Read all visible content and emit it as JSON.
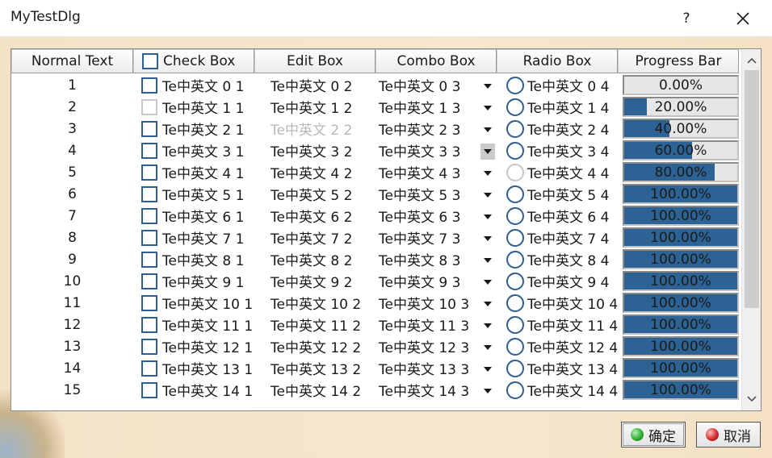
{
  "window": {
    "title": "MyTestDlg",
    "help_label": "?",
    "close_icon": "close-icon"
  },
  "columns": [
    "Normal Text",
    "Check Box",
    "Edit Box",
    "Combo Box",
    "Radio Box",
    "Progress Bar"
  ],
  "rows": [
    {
      "num": "1",
      "check": "Te中英文 0 1",
      "edit": "Te中英文 0 2",
      "combo": "Te中英文 0 3",
      "radio": "Te中英文 0 4",
      "progress": 0.0,
      "progress_text": "0.00%",
      "check_enabled": true,
      "edit_enabled": true,
      "combo_active": false,
      "radio_enabled": true
    },
    {
      "num": "2",
      "check": "Te中英文 1 1",
      "edit": "Te中英文 1 2",
      "combo": "Te中英文 1 3",
      "radio": "Te中英文 1 4",
      "progress": 20.0,
      "progress_text": "20.00%",
      "check_enabled": false,
      "edit_enabled": true,
      "combo_active": false,
      "radio_enabled": true
    },
    {
      "num": "3",
      "check": "Te中英文 2 1",
      "edit": "Te中英文 2 2",
      "combo": "Te中英文 2 3",
      "radio": "Te中英文 2 4",
      "progress": 40.0,
      "progress_text": "40.00%",
      "check_enabled": true,
      "edit_enabled": false,
      "combo_active": false,
      "radio_enabled": true
    },
    {
      "num": "4",
      "check": "Te中英文 3 1",
      "edit": "Te中英文 3 2",
      "combo": "Te中英文 3 3",
      "radio": "Te中英文 3 4",
      "progress": 60.0,
      "progress_text": "60.00%",
      "check_enabled": true,
      "edit_enabled": true,
      "combo_active": true,
      "radio_enabled": true
    },
    {
      "num": "5",
      "check": "Te中英文 4 1",
      "edit": "Te中英文 4 2",
      "combo": "Te中英文 4 3",
      "radio": "Te中英文 4 4",
      "progress": 80.0,
      "progress_text": "80.00%",
      "check_enabled": true,
      "edit_enabled": true,
      "combo_active": false,
      "radio_enabled": false
    },
    {
      "num": "6",
      "check": "Te中英文 5 1",
      "edit": "Te中英文 5 2",
      "combo": "Te中英文 5 3",
      "radio": "Te中英文 5 4",
      "progress": 100.0,
      "progress_text": "100.00%",
      "check_enabled": true,
      "edit_enabled": true,
      "combo_active": false,
      "radio_enabled": true
    },
    {
      "num": "7",
      "check": "Te中英文 6 1",
      "edit": "Te中英文 6 2",
      "combo": "Te中英文 6 3",
      "radio": "Te中英文 6 4",
      "progress": 100.0,
      "progress_text": "100.00%",
      "check_enabled": true,
      "edit_enabled": true,
      "combo_active": false,
      "radio_enabled": true
    },
    {
      "num": "8",
      "check": "Te中英文 7 1",
      "edit": "Te中英文 7 2",
      "combo": "Te中英文 7 3",
      "radio": "Te中英文 7 4",
      "progress": 100.0,
      "progress_text": "100.00%",
      "check_enabled": true,
      "edit_enabled": true,
      "combo_active": false,
      "radio_enabled": true
    },
    {
      "num": "9",
      "check": "Te中英文 8 1",
      "edit": "Te中英文 8 2",
      "combo": "Te中英文 8 3",
      "radio": "Te中英文 8 4",
      "progress": 100.0,
      "progress_text": "100.00%",
      "check_enabled": true,
      "edit_enabled": true,
      "combo_active": false,
      "radio_enabled": true
    },
    {
      "num": "10",
      "check": "Te中英文 9 1",
      "edit": "Te中英文 9 2",
      "combo": "Te中英文 9 3",
      "radio": "Te中英文 9 4",
      "progress": 100.0,
      "progress_text": "100.00%",
      "check_enabled": true,
      "edit_enabled": true,
      "combo_active": false,
      "radio_enabled": true
    },
    {
      "num": "11",
      "check": "Te中英文 10 1",
      "edit": "Te中英文 10 2",
      "combo": "Te中英文 10 3",
      "radio": "Te中英文 10 4",
      "progress": 100.0,
      "progress_text": "100.00%",
      "check_enabled": true,
      "edit_enabled": true,
      "combo_active": false,
      "radio_enabled": true
    },
    {
      "num": "12",
      "check": "Te中英文 11 1",
      "edit": "Te中英文 11 2",
      "combo": "Te中英文 11 3",
      "radio": "Te中英文 11 4",
      "progress": 100.0,
      "progress_text": "100.00%",
      "check_enabled": true,
      "edit_enabled": true,
      "combo_active": false,
      "radio_enabled": true
    },
    {
      "num": "13",
      "check": "Te中英文 12 1",
      "edit": "Te中英文 12 2",
      "combo": "Te中英文 12 3",
      "radio": "Te中英文 12 4",
      "progress": 100.0,
      "progress_text": "100.00%",
      "check_enabled": true,
      "edit_enabled": true,
      "combo_active": false,
      "radio_enabled": true
    },
    {
      "num": "14",
      "check": "Te中英文 13 1",
      "edit": "Te中英文 13 2",
      "combo": "Te中英文 13 3",
      "radio": "Te中英文 13 4",
      "progress": 100.0,
      "progress_text": "100.00%",
      "check_enabled": true,
      "edit_enabled": true,
      "combo_active": false,
      "radio_enabled": true
    },
    {
      "num": "15",
      "check": "Te中英文 14 1",
      "edit": "Te中英文 14 2",
      "combo": "Te中英文 14 3",
      "radio": "Te中英文 14 4",
      "progress": 100.0,
      "progress_text": "100.00%",
      "check_enabled": true,
      "edit_enabled": true,
      "combo_active": false,
      "radio_enabled": true
    }
  ],
  "buttons": {
    "ok_label": "确定",
    "cancel_label": "取消",
    "ok_icon": "green-dot-icon",
    "cancel_icon": "red-dot-icon"
  },
  "colors": {
    "progress_fill": "#2c6394",
    "checkbox_border": "#2f5f92",
    "ok_dot": "#2fae2f",
    "cancel_dot": "#d42a2a",
    "dialog_bg": "#f4e2c6"
  }
}
